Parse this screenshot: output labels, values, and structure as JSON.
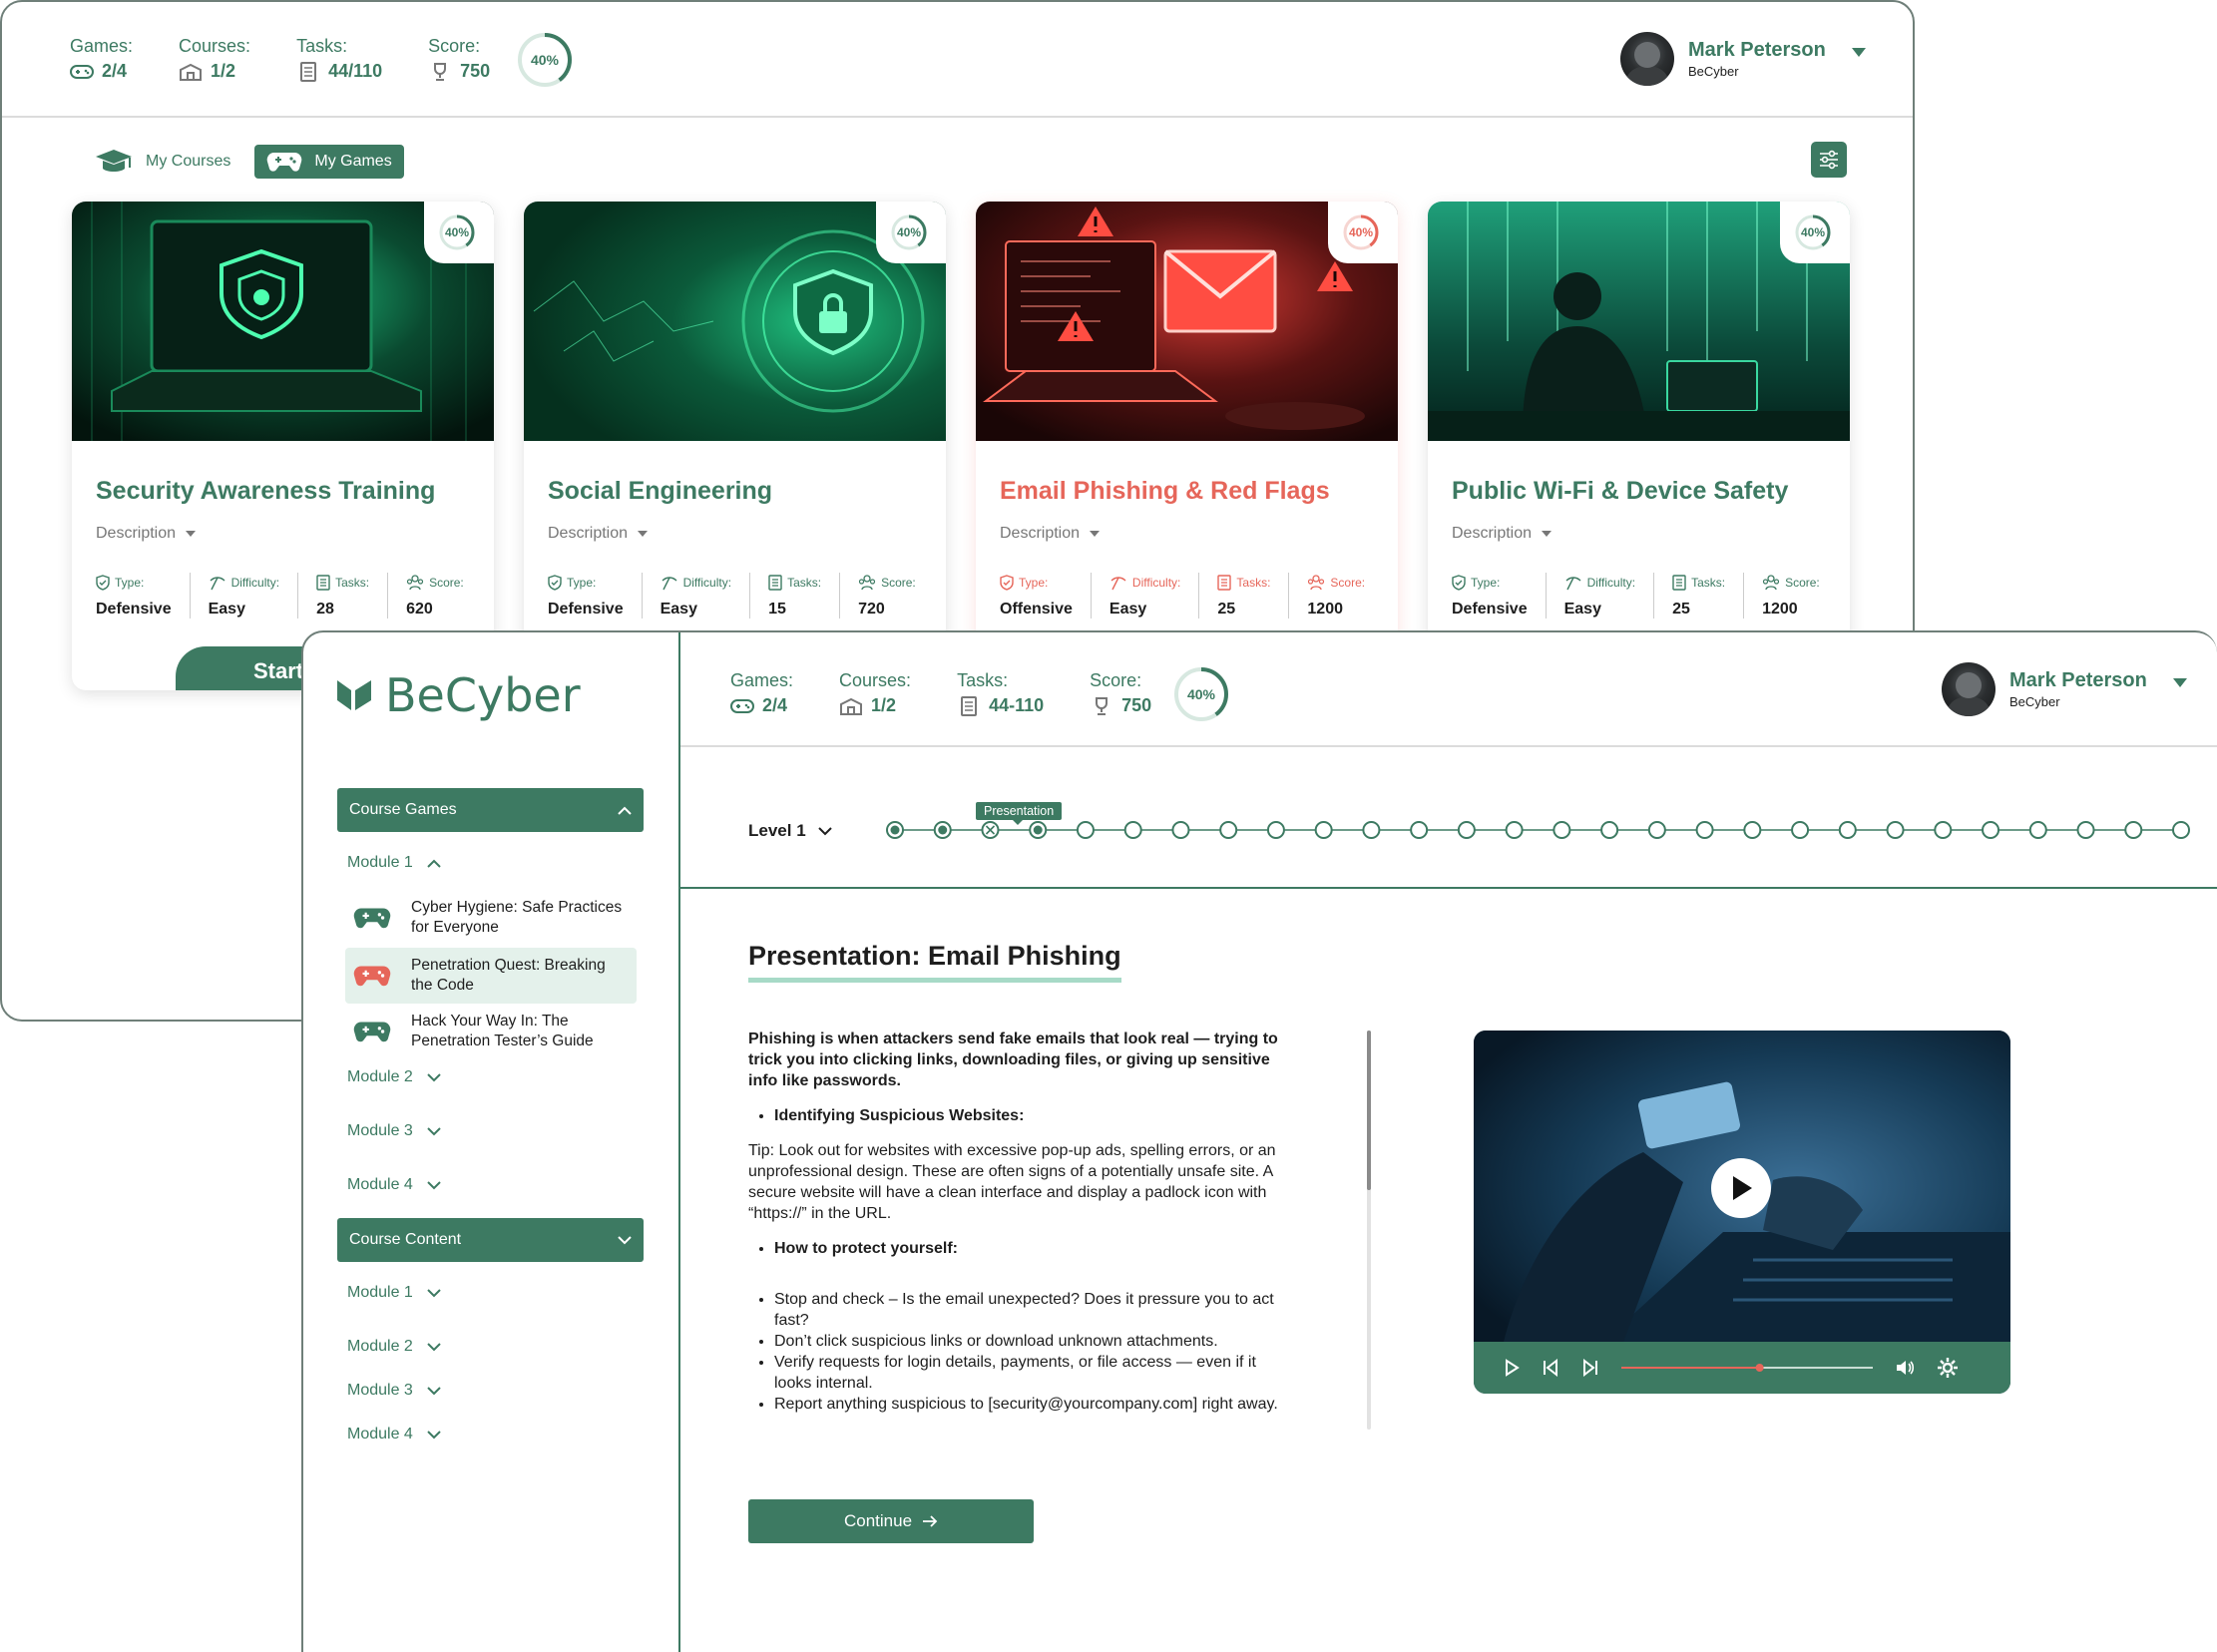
{
  "colors": {
    "accent": "#3d7a62",
    "accent_light": "#a7dac7",
    "alert": "#e6665a"
  },
  "back_window": {
    "stats": [
      {
        "label": "Games:",
        "value": "2/4",
        "icon": "gamepad-icon"
      },
      {
        "label": "Courses:",
        "value": "1/2",
        "icon": "courses-icon"
      },
      {
        "label": "Tasks:",
        "value": "44/110",
        "icon": "tasks-icon"
      },
      {
        "label": "Score:",
        "value": "750",
        "icon": "trophy-icon"
      }
    ],
    "progress": {
      "label": "40%",
      "value": 0.4
    },
    "user": {
      "name": "Mark Peterson",
      "org": "BeCyber"
    },
    "tabs": [
      {
        "label": "My Courses",
        "active": false
      },
      {
        "label": "My Games",
        "active": true
      }
    ],
    "cards": [
      {
        "title": "Security Awareness Training",
        "description": "Description",
        "progress": "40%",
        "type_label": "Type:",
        "type": "Defensive",
        "difficulty_label": "Difficulty:",
        "difficulty": "Easy",
        "tasks_label": "Tasks:",
        "tasks": "28",
        "score_label": "Score:",
        "score": "620",
        "start_label": "Start"
      },
      {
        "title": "Social Engineering",
        "description": "Description",
        "progress": "40%",
        "type_label": "Type:",
        "type": "Defensive",
        "difficulty_label": "Difficulty:",
        "difficulty": "Easy",
        "tasks_label": "Tasks:",
        "tasks": "15",
        "score_label": "Score:",
        "score": "720"
      },
      {
        "title": "Email Phishing & Red Flags",
        "description": "Description",
        "progress": "40%",
        "type_label": "Type:",
        "type": "Offensive",
        "difficulty_label": "Difficulty:",
        "difficulty": "Easy",
        "tasks_label": "Tasks:",
        "tasks": "25",
        "score_label": "Score:",
        "score": "1200"
      },
      {
        "title": "Public Wi-Fi & Device Safety",
        "description": "Description",
        "progress": "40%",
        "type_label": "Type:",
        "type": "Defensive",
        "difficulty_label": "Difficulty:",
        "difficulty": "Easy",
        "tasks_label": "Tasks:",
        "tasks": "25",
        "score_label": "Score:",
        "score": "1200"
      }
    ]
  },
  "front_window": {
    "logo": "BeCyber",
    "stats": [
      {
        "label": "Games:",
        "value": "2/4"
      },
      {
        "label": "Courses:",
        "value": "1/2"
      },
      {
        "label": "Tasks:",
        "value": "44-110"
      },
      {
        "label": "Score:",
        "value": "750"
      }
    ],
    "progress": {
      "label": "40%",
      "value": 0.4
    },
    "user": {
      "name": "Mark Peterson",
      "org": "BeCyber"
    },
    "sidebar": {
      "games_header": "Course Games",
      "module1": "Module 1",
      "games": [
        "Cyber Hygiene: Safe Practices for Everyone",
        "Penetration Quest: Breaking the Code",
        "Hack Your Way In: The Penetration Tester’s Guide"
      ],
      "module2": "Module 2",
      "module3": "Module 3",
      "module4": "Module 4",
      "content_header": "Course Content",
      "content_modules": [
        "Module 1",
        "Module 2",
        "Module 3",
        "Module 4"
      ]
    },
    "level": {
      "label": "Level 1",
      "tooltip": "Presentation",
      "total_steps": 28,
      "completed_steps": 2,
      "failed_step": 3,
      "current_step": 4
    },
    "content": {
      "title": "Presentation: Email Phishing",
      "intro": "Phishing is when attackers send fake emails that look real — trying to trick you into clicking links, downloading files, or giving up sensitive info like passwords.",
      "bullet1": "Identifying Suspicious Websites:",
      "tip": "Tip: Look out for websites with excessive pop-up ads, spelling errors, or an unprofessional design. These are often signs of a potentially unsafe site. A secure website will have a clean interface and display a padlock icon with “https://” in the URL.",
      "bullet2": "How to protect yourself:",
      "steps": [
        "Stop and check – Is the email unexpected? Does it pressure you to act fast?",
        "Don’t click suspicious links or download unknown attachments.",
        "Verify requests for login details, payments, or file access — even if it looks internal.",
        "Report anything suspicious to [security@yourcompany.com] right away."
      ],
      "continue_label": "Continue",
      "video_progress": 0.55
    }
  }
}
